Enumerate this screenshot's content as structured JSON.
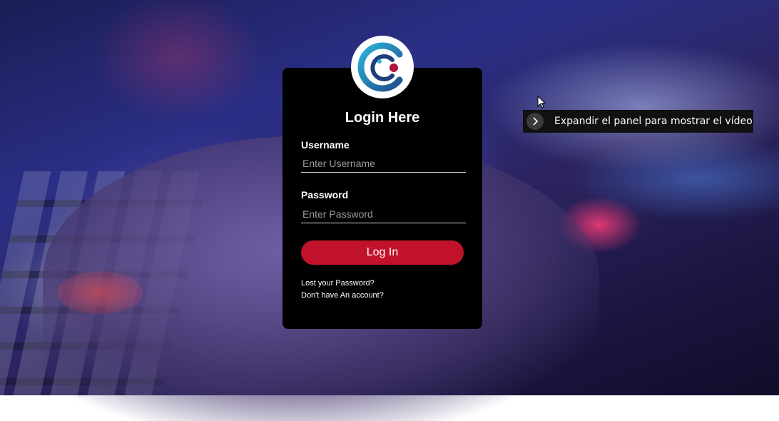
{
  "login": {
    "title": "Login Here",
    "username_label": "Username",
    "username_placeholder": "Enter Username",
    "username_value": "",
    "password_label": "Password",
    "password_placeholder": "Enter Password",
    "password_value": "",
    "submit_label": "Log In",
    "lost_password_link": "Lost your Password?",
    "signup_link": "Don't have An account?"
  },
  "logo": {
    "icon": "brand-logo-icon"
  },
  "tooltip": {
    "text": "Expandir el panel para mostrar el vídeo",
    "icon": "chevron-right-icon"
  },
  "colors": {
    "card_background": "#000000",
    "accent": "#c0132b",
    "text": "#ffffff",
    "placeholder": "#9a9a9a"
  }
}
